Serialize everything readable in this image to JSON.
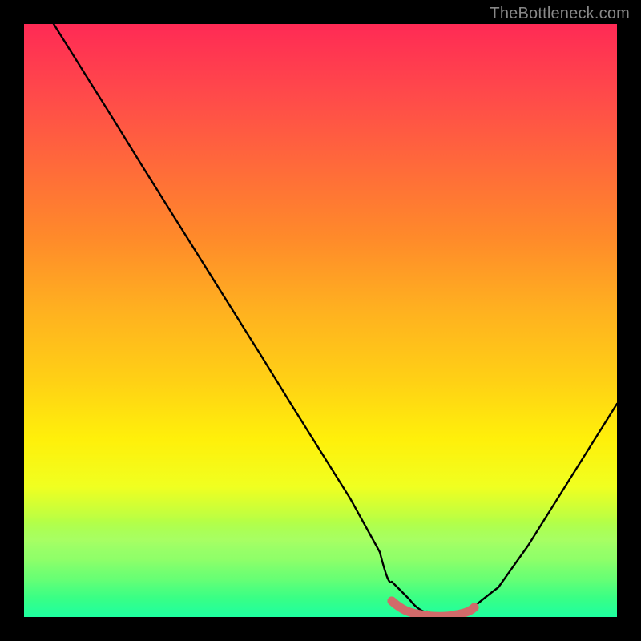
{
  "attribution": "TheBottleneck.com",
  "colors": {
    "bg": "#000000",
    "curve": "#000000",
    "valley_marker": "#d16a6a",
    "gradient_top": "#ff2a55",
    "gradient_bottom": "#10ffb0"
  },
  "chart_data": {
    "type": "line",
    "title": "",
    "xlabel": "",
    "ylabel": "",
    "xlim": [
      0,
      100
    ],
    "ylim": [
      0,
      100
    ],
    "grid": false,
    "legend": false,
    "series": [
      {
        "name": "bottleneck-curve",
        "x": [
          5,
          10,
          15,
          20,
          25,
          30,
          35,
          40,
          45,
          50,
          55,
          60,
          62,
          65,
          68,
          70,
          72,
          75,
          80,
          85,
          90,
          95,
          100
        ],
        "y": [
          100,
          92,
          84,
          76,
          68,
          60,
          52,
          44,
          36,
          28,
          20,
          11,
          6,
          3,
          1,
          0,
          0,
          1,
          5,
          12,
          20,
          28,
          36
        ]
      }
    ],
    "annotations": [
      {
        "name": "optimal-valley",
        "x_range": [
          62,
          76
        ],
        "y": 1,
        "style": "thick-rounded",
        "color": "#d16a6a"
      }
    ]
  }
}
